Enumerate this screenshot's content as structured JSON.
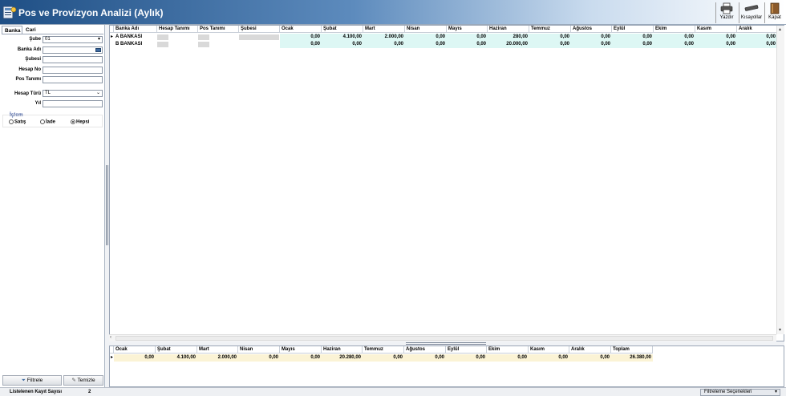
{
  "window": {
    "title": "Pos ve Provizyon Analizi (Aylık)"
  },
  "toolbar": [
    {
      "label": "Yazdır",
      "icon": "printer-icon"
    },
    {
      "label": "Kısayollar",
      "icon": "shortcuts-icon"
    },
    {
      "label": "Kapat",
      "icon": "close-book-icon"
    }
  ],
  "tabs": [
    {
      "label": "Banka"
    },
    {
      "label": "Cari"
    }
  ],
  "filters": {
    "sube": {
      "label": "Şube",
      "value": "01"
    },
    "banka_adi": {
      "label": "Banka Adı",
      "value": ""
    },
    "subesi": {
      "label": "Şubesi",
      "value": ""
    },
    "hesap_no": {
      "label": "Hesap No",
      "value": ""
    },
    "pos_tanimi": {
      "label": "Pos Tanımı",
      "value": ""
    },
    "hesap_turu": {
      "label": "Hesap Türü",
      "value": "TL"
    },
    "yil": {
      "label": "Yıl",
      "value": ""
    }
  },
  "islem": {
    "label": "İşlem",
    "options": [
      {
        "label": "Satış",
        "selected": false
      },
      {
        "label": "İade",
        "selected": false
      },
      {
        "label": "Hepsi",
        "selected": true
      }
    ]
  },
  "buttons": {
    "filter": "Filtrele",
    "clear": "Temizle"
  },
  "status": {
    "label": "Listelenen Kayıt Sayısı",
    "count": "2",
    "filter_options": "Filtreleme Seçenekleri"
  },
  "main_grid": {
    "columns": [
      "Banka Adı",
      "Hesap Tanımı",
      "Pos Tanımı",
      "Şubesi",
      "Ocak",
      "Şubat",
      "Mart",
      "Nisan",
      "Mayıs",
      "Haziran",
      "Temmuz",
      "Ağustos",
      "Eylül",
      "Ekim",
      "Kasım",
      "Aralık"
    ],
    "rows": [
      {
        "banka": "A BANKASI",
        "months": [
          "0,00",
          "4.100,00",
          "2.000,00",
          "0,00",
          "0,00",
          "280,00",
          "0,00",
          "0,00",
          "0,00",
          "0,00",
          "0,00",
          "0,00"
        ]
      },
      {
        "banka": "B BANKASI",
        "months": [
          "0,00",
          "0,00",
          "0,00",
          "0,00",
          "0,00",
          "20.000,00",
          "0,00",
          "0,00",
          "0,00",
          "0,00",
          "0,00",
          "0,00"
        ]
      }
    ]
  },
  "summary_grid": {
    "columns": [
      "Ocak",
      "Şubat",
      "Mart",
      "Nisan",
      "Mayıs",
      "Haziran",
      "Temmuz",
      "Ağustos",
      "Eylül",
      "Ekim",
      "Kasım",
      "Aralık",
      "Toplam"
    ],
    "row": [
      "0,00",
      "4.100,00",
      "2.000,00",
      "0,00",
      "0,00",
      "20.280,00",
      "0,00",
      "0,00",
      "0,00",
      "0,00",
      "0,00",
      "0,00",
      "26.380,00"
    ]
  },
  "colors": {
    "title_gradient_start": "#1f4f85",
    "row_highlight": "#ddf7f4",
    "summary_highlight": "#fbf3d5",
    "group_label": "#1d3c8e"
  }
}
